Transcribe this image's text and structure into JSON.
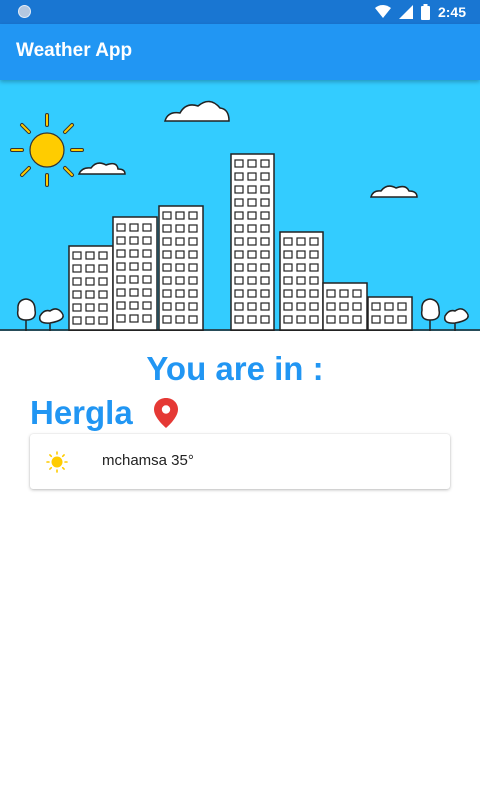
{
  "status_bar": {
    "time": "2:45",
    "icons": [
      "notification-dot-icon",
      "wifi-icon",
      "cell-signal-icon",
      "battery-icon"
    ]
  },
  "app_bar": {
    "title": "Weather App"
  },
  "banner": {
    "illustration": "city-skyline-with-sun-and-clouds"
  },
  "location": {
    "heading": "You are in :",
    "city": "Hergla",
    "pin_icon": "location-pin-icon"
  },
  "weather": {
    "icon": "sun-icon",
    "text": "mchamsa 35°"
  },
  "colors": {
    "status_bar": "#1976D2",
    "app_bar": "#2196F3",
    "sky": "#33CCFF",
    "accent_text": "#2196F3",
    "sun": "#FFCC00",
    "pin": "#E53935"
  }
}
